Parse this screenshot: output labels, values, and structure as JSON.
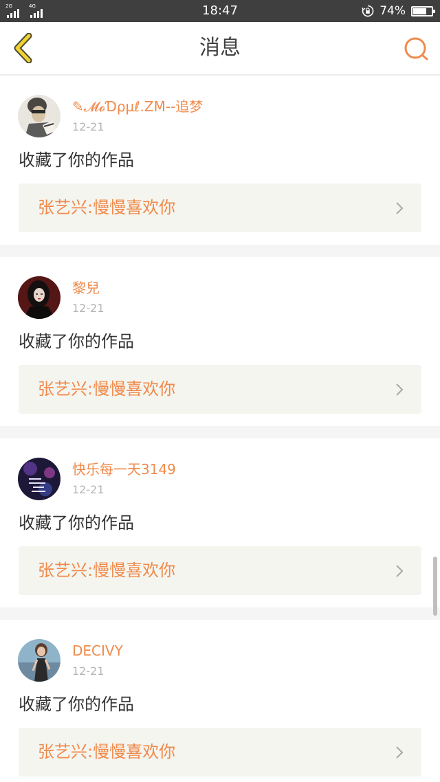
{
  "status_bar": {
    "signal_1_label": "2G",
    "signal_2_label": "4G",
    "time": "18:47",
    "battery_percent": "74%",
    "battery_level": 0.74
  },
  "header": {
    "title": "消息",
    "back_icon": "chevron-left-icon",
    "search_icon": "search-icon"
  },
  "colors": {
    "accent": "#f08a4b",
    "back_accent": "#f2d230",
    "card_background": "#f5f5ef",
    "date_gray": "#b4b4b4"
  },
  "messages": [
    {
      "user": "✎𝓜𝓸Ɗρµℓ.ZM--追梦",
      "date": "12-21",
      "action": "收藏了你的作品",
      "work": "张艺兴:慢慢喜欢你"
    },
    {
      "user": "黎兒",
      "date": "12-21",
      "action": "收藏了你的作品",
      "work": "张艺兴:慢慢喜欢你"
    },
    {
      "user": "快乐每一天3149",
      "date": "12-21",
      "action": "收藏了你的作品",
      "work": "张艺兴:慢慢喜欢你"
    },
    {
      "user": "DECIVY",
      "date": "12-21",
      "action": "收藏了你的作品",
      "work": "张艺兴:慢慢喜欢你"
    }
  ]
}
